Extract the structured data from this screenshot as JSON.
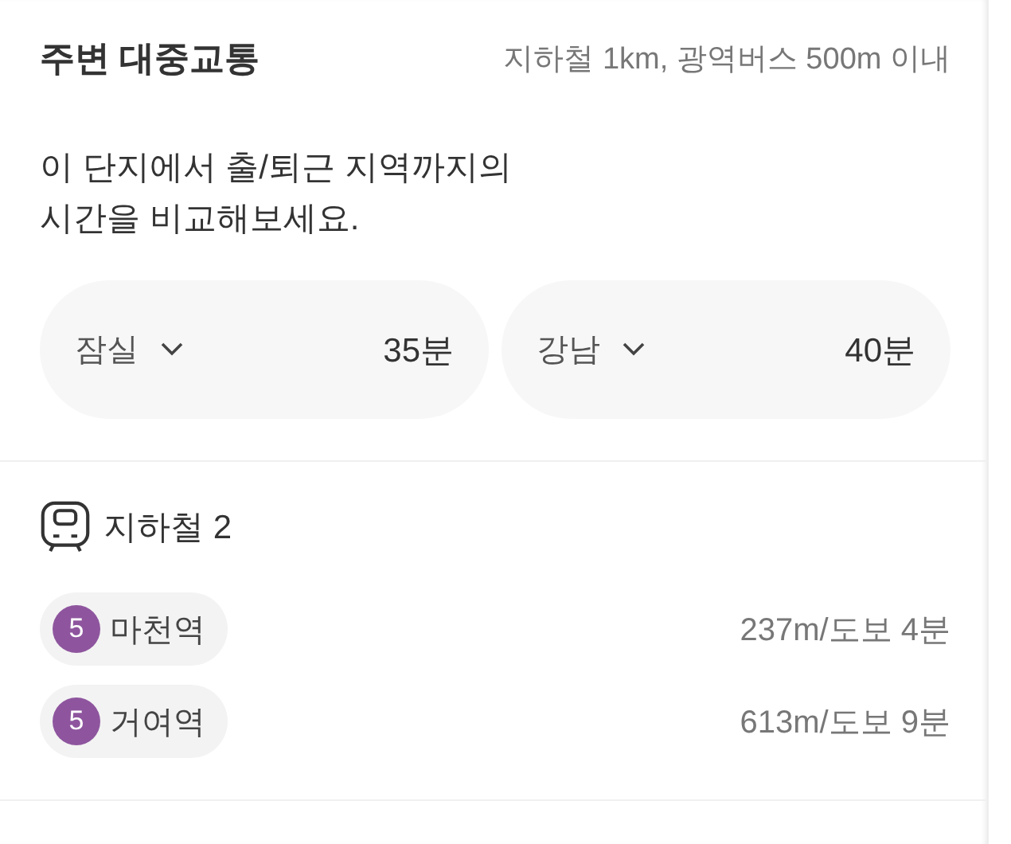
{
  "header": {
    "title": "주변 대중교통",
    "criteria": "지하철 1km, 광역버스 500m 이내"
  },
  "description": "이 단지에서 출/퇴근 지역까지의\n시간을 비교해보세요.",
  "commutes": [
    {
      "destination": "잠실",
      "time": "35분"
    },
    {
      "destination": "강남",
      "time": "40분"
    }
  ],
  "subway": {
    "title": "지하철 2",
    "stations": [
      {
        "line": "5",
        "color": "#8e559e",
        "name": "마천역",
        "distance": "237m/도보 4분"
      },
      {
        "line": "5",
        "color": "#8e559e",
        "name": "거여역",
        "distance": "613m/도보 9분"
      }
    ]
  }
}
